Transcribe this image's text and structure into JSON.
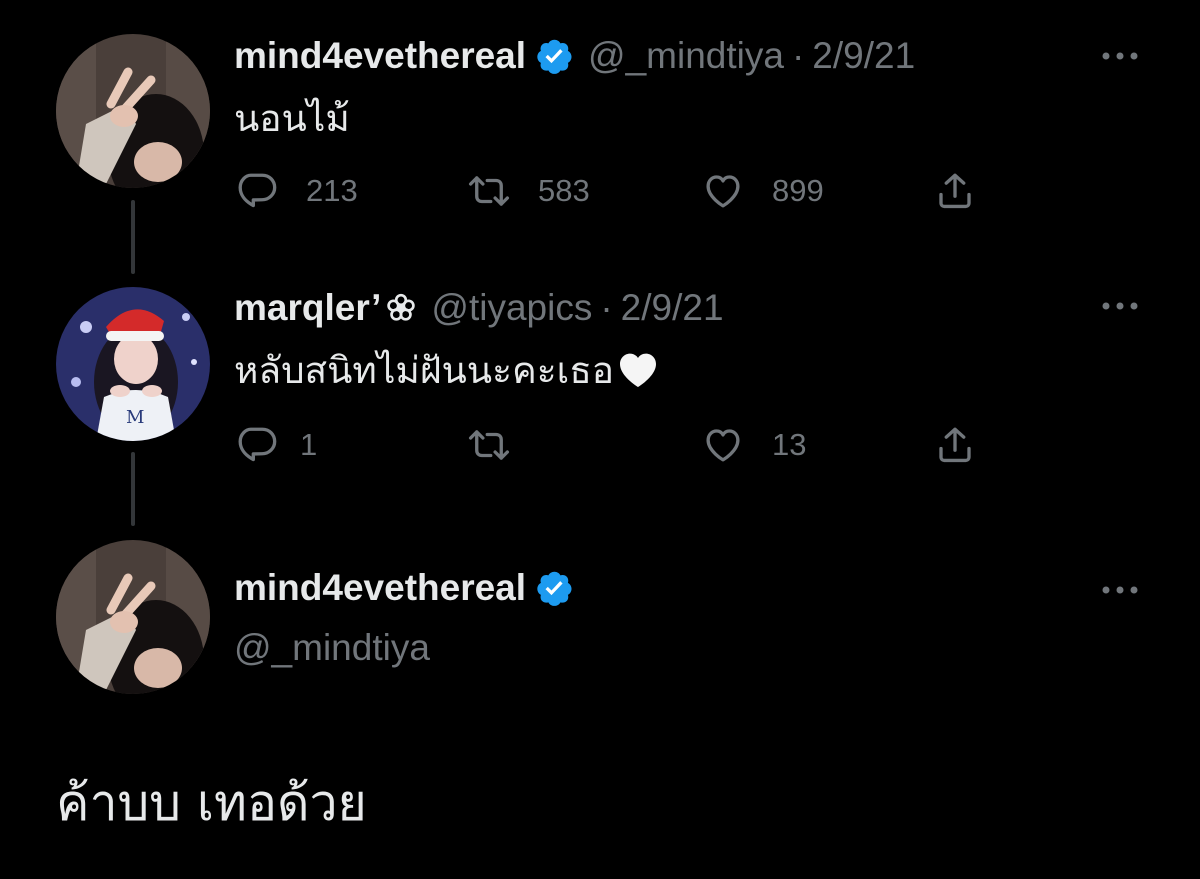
{
  "tweets": [
    {
      "display_name": "mind4evethereal",
      "verified": true,
      "handle": "@_mindtiya",
      "separator": "·",
      "date": "2/9/21",
      "text": "นอนไม้",
      "replies": "213",
      "retweets": "583",
      "likes": "899"
    },
    {
      "display_name": "marqler’",
      "verified": false,
      "handle": "@tiyapics",
      "separator": "·",
      "date": "2/9/21",
      "text": "หลับสนิทไม่ฝันนะคะเธอ",
      "replies": "1",
      "retweets": "",
      "likes": "13"
    }
  ],
  "focused": {
    "display_name": "mind4evethereal",
    "verified": true,
    "handle": "@_mindtiya",
    "text": "ค้าบบ เทอด้วย"
  },
  "colors": {
    "background": "#000000",
    "text": "#e7e9ea",
    "secondary": "#71767b",
    "verified": "#1d9bf0",
    "thread_line": "#333639"
  },
  "icons": [
    "reply-icon",
    "retweet-icon",
    "like-icon",
    "share-icon",
    "verified-badge-icon",
    "more-icon",
    "white-heart-emoji",
    "flower-icon"
  ]
}
